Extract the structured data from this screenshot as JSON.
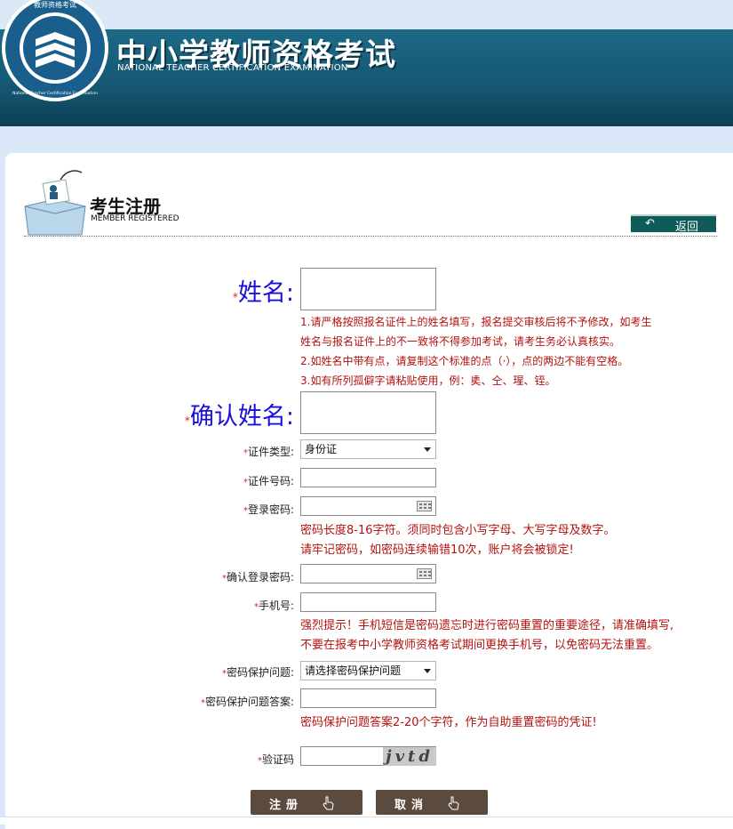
{
  "header": {
    "logo_text": "教师资格考试",
    "logo_ring_text": "National Teacher Certification Examination",
    "title": "中小学教师资格考试",
    "subtitle": "NATIONAL TEACHER CERTIFICATION EXAMINATION"
  },
  "section": {
    "title": "考生注册",
    "subtitle": "MEMBER REGISTERED",
    "back_label": "返回"
  },
  "form": {
    "required_mark": "*",
    "name_label": "姓名:",
    "confirm_name_label": "确认姓名:",
    "name_notes": [
      "1.请严格按照报名证件上的姓名填写，报名提交审核后将不予修改，如考生",
      "姓名与报名证件上的不一致将不得参加考试，请考生务必认真核实。",
      "2.如姓名中带有点，请复制这个标准的点（·），点的两边不能有空格。",
      "3.如有所列孤僻字请粘贴使用，例：奊、仝、瑆、铚。"
    ],
    "id_type_label": "证件类型:",
    "id_type_value": "身份证",
    "id_number_label": "证件号码:",
    "password_label": "登录密码:",
    "password_notes": [
      "密码长度8-16字符。须同时包含小写字母、大写字母及数字。",
      "请牢记密码，如密码连续输错10次，账户将会被锁定!"
    ],
    "confirm_password_label": "确认登录密码:",
    "phone_label": "手机号:",
    "phone_notes": [
      "强烈提示！手机短信是密码遗忘时进行密码重置的重要途径，请准确填写,",
      "不要在报考中小学教师资格考试期间更换手机号，以免密码无法重置。"
    ],
    "question_label": "密码保护问题:",
    "question_value": "请选择密码保护问题",
    "answer_label": "密码保护问题答案:",
    "answer_note": "密码保护问题答案2-20个字符，作为自助重置密码的凭证!",
    "captcha_label": "验证码",
    "captcha_text": "jvtd"
  },
  "buttons": {
    "register": "注册",
    "cancel": "取消"
  },
  "colors": {
    "header_band": "#155873",
    "label_blue": "#1a0fd9",
    "note_red": "#b3120f",
    "button_brown": "#5b4a3e",
    "back_green": "#0f5b57"
  }
}
